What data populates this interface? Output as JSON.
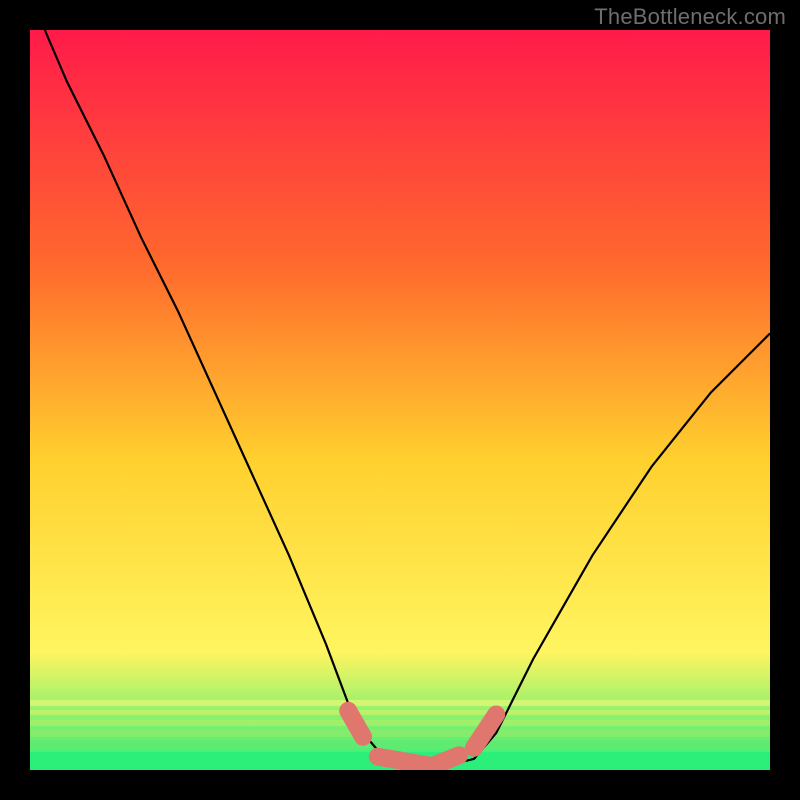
{
  "watermark": "TheBottleneck.com",
  "colors": {
    "bg": "#000000",
    "gradient_top": "#ff1a4a",
    "gradient_mid1": "#ff6a2d",
    "gradient_mid2": "#ffd02e",
    "gradient_mid3": "#fff560",
    "gradient_bottom": "#2bee7a",
    "curve": "#000000",
    "band": "#e0776f"
  },
  "chart_data": {
    "type": "line",
    "title": "",
    "xlabel": "",
    "ylabel": "",
    "xlim": [
      0,
      100
    ],
    "ylim": [
      0,
      100
    ],
    "x": [
      2,
      5,
      10,
      15,
      20,
      25,
      30,
      35,
      40,
      43,
      45,
      48,
      51,
      54,
      57,
      60,
      63,
      65,
      68,
      72,
      76,
      80,
      84,
      88,
      92,
      96,
      100
    ],
    "values": [
      100,
      93,
      83,
      72,
      62,
      51,
      40,
      29,
      17,
      9,
      5,
      1.5,
      0.5,
      0.5,
      0.8,
      1.5,
      5,
      9,
      15,
      22,
      29,
      35,
      41,
      46,
      51,
      55,
      59
    ],
    "band_segments": [
      {
        "x0": 43,
        "y0": 8,
        "x1": 45,
        "y1": 4.5
      },
      {
        "x0": 47,
        "y0": 1.8,
        "x1": 54,
        "y1": 0.6
      },
      {
        "x0": 55,
        "y0": 0.8,
        "x1": 58,
        "y1": 2.0
      },
      {
        "x0": 60,
        "y0": 3.0,
        "x1": 63,
        "y1": 7.5
      }
    ],
    "annotations": []
  }
}
